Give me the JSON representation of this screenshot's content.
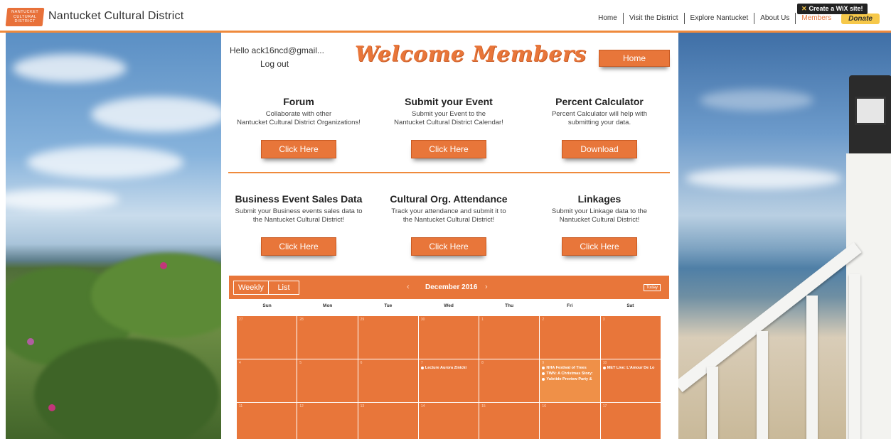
{
  "header": {
    "logo_text": "NANTUCKET CULTURAL DISTRICT",
    "site_title": "Nantucket Cultural District",
    "nav": [
      "Home",
      "Visit the District",
      "Explore Nantucket",
      "About Us",
      "Members"
    ],
    "active_nav": "Members",
    "donate_label": "Donate",
    "wix_banner": "Create a WiX site!"
  },
  "member": {
    "greeting": "Hello ack16ncd@gmail...",
    "logout_label": "Log out",
    "welcome_title": "Welcome Members",
    "home_button": "Home"
  },
  "cards": [
    {
      "title": "Forum",
      "desc_line1": "Collaborate with other",
      "desc_line2": "Nantucket Cultural District Organizations!",
      "button": "Click Here"
    },
    {
      "title": "Submit your Event",
      "desc_line1": "Submit your Event to the",
      "desc_line2": "Nantucket Cultural District Calendar!",
      "button": "Click Here"
    },
    {
      "title": "Percent Calculator",
      "desc_line1": "Percent Calculator will help with",
      "desc_line2": "submitting your data.",
      "button": "Download"
    },
    {
      "title": "Business Event Sales Data",
      "desc_line1": "Submit your Business events sales data to",
      "desc_line2": "the Nantucket Cultural District!",
      "button": "Click Here"
    },
    {
      "title": "Cultural Org. Attendance",
      "desc_line1": "Track your attendance and submit it to",
      "desc_line2": "the Nantucket Cultural District!",
      "button": "Click Here"
    },
    {
      "title": "Linkages",
      "desc_line1": "Submit your Linkage data to the",
      "desc_line2": "Nantucket Cultural District!",
      "button": "Click Here"
    }
  ],
  "calendar": {
    "weekly_tab": "Weekly",
    "list_tab": "List",
    "month": "December 2016",
    "prev_arrow": "‹",
    "next_arrow": "›",
    "today_label": "Today",
    "days": [
      "Sun",
      "Mon",
      "Tue",
      "Wed",
      "Thu",
      "Fri",
      "Sat"
    ],
    "weeks": [
      [
        {
          "n": "27",
          "ev": []
        },
        {
          "n": "28",
          "ev": []
        },
        {
          "n": "29",
          "ev": []
        },
        {
          "n": "30",
          "ev": []
        },
        {
          "n": "1",
          "ev": []
        },
        {
          "n": "2",
          "ev": []
        },
        {
          "n": "3",
          "ev": []
        }
      ],
      [
        {
          "n": "4",
          "ev": []
        },
        {
          "n": "5",
          "ev": []
        },
        {
          "n": "6",
          "ev": []
        },
        {
          "n": "7",
          "ev": [
            "Lecture Aurora Zinicki"
          ]
        },
        {
          "n": "8",
          "ev": []
        },
        {
          "n": "9",
          "ev": [
            "NHA Festival of Trees",
            "TWN: A Christmas Story:",
            "Yuletide Preview Party &"
          ],
          "today": true
        },
        {
          "n": "10",
          "ev": [
            "MET Live: L'Amour De Lo"
          ]
        }
      ],
      [
        {
          "n": "11",
          "ev": []
        },
        {
          "n": "12",
          "ev": []
        },
        {
          "n": "13",
          "ev": []
        },
        {
          "n": "14",
          "ev": []
        },
        {
          "n": "15",
          "ev": []
        },
        {
          "n": "16",
          "ev": []
        },
        {
          "n": "17",
          "ev": []
        }
      ]
    ]
  }
}
